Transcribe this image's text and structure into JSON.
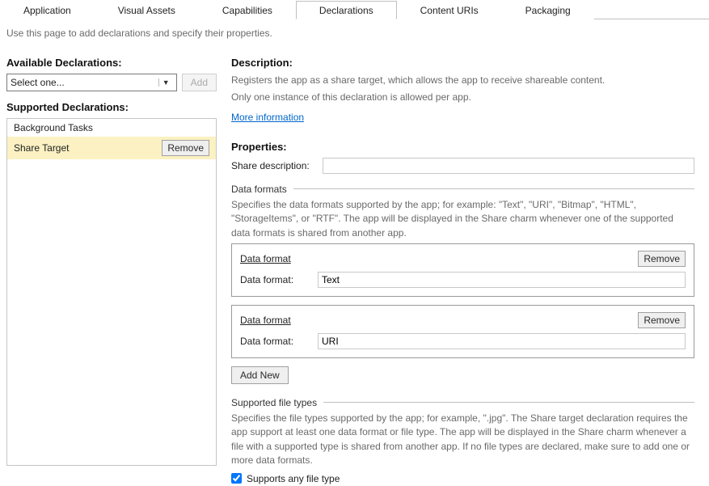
{
  "tabs": [
    "Application",
    "Visual Assets",
    "Capabilities",
    "Declarations",
    "Content URIs",
    "Packaging"
  ],
  "activeTab": 3,
  "pageHint": "Use this page to add declarations and specify their properties.",
  "left": {
    "availTitle": "Available Declarations:",
    "selectPlaceholder": "Select one...",
    "addBtn": "Add",
    "supportedTitle": "Supported Declarations:",
    "items": [
      {
        "label": "Background Tasks",
        "selected": false
      },
      {
        "label": "Share Target",
        "selected": true
      }
    ],
    "removeBtn": "Remove"
  },
  "right": {
    "descriptionTitle": "Description:",
    "descriptionLine1": "Registers the app as a share target, which allows the app to receive shareable content.",
    "descriptionLine2": "Only one instance of this declaration is allowed per app.",
    "moreInfo": "More information",
    "propertiesTitle": "Properties:",
    "shareDescLabel": "Share description:",
    "shareDescValue": "",
    "dataFormatsGroup": "Data formats",
    "dataFormatsHelp": "Specifies the data formats supported by the app; for example: \"Text\", \"URI\", \"Bitmap\", \"HTML\", \"StorageItems\", or \"RTF\". The app will be displayed in the Share charm whenever one of the supported data formats is shared from another app.",
    "dataFormatTitle": "Data format",
    "dataFormatLabel": "Data format:",
    "dataFormats": [
      {
        "value": "Text"
      },
      {
        "value": "URI"
      }
    ],
    "removeBtn": "Remove",
    "addNewBtn": "Add New",
    "fileTypesGroup": "Supported file types",
    "fileTypesHelp": "Specifies the file types supported by the app; for example, \".jpg\". The Share target declaration requires the app support at least one data format or file type. The app will be displayed in the Share charm whenever a file with a supported type is shared from another app. If no file types are declared, make sure to add one or more data formats.",
    "supportsAnyLabel": "Supports any file type",
    "supportsAnyChecked": true
  }
}
